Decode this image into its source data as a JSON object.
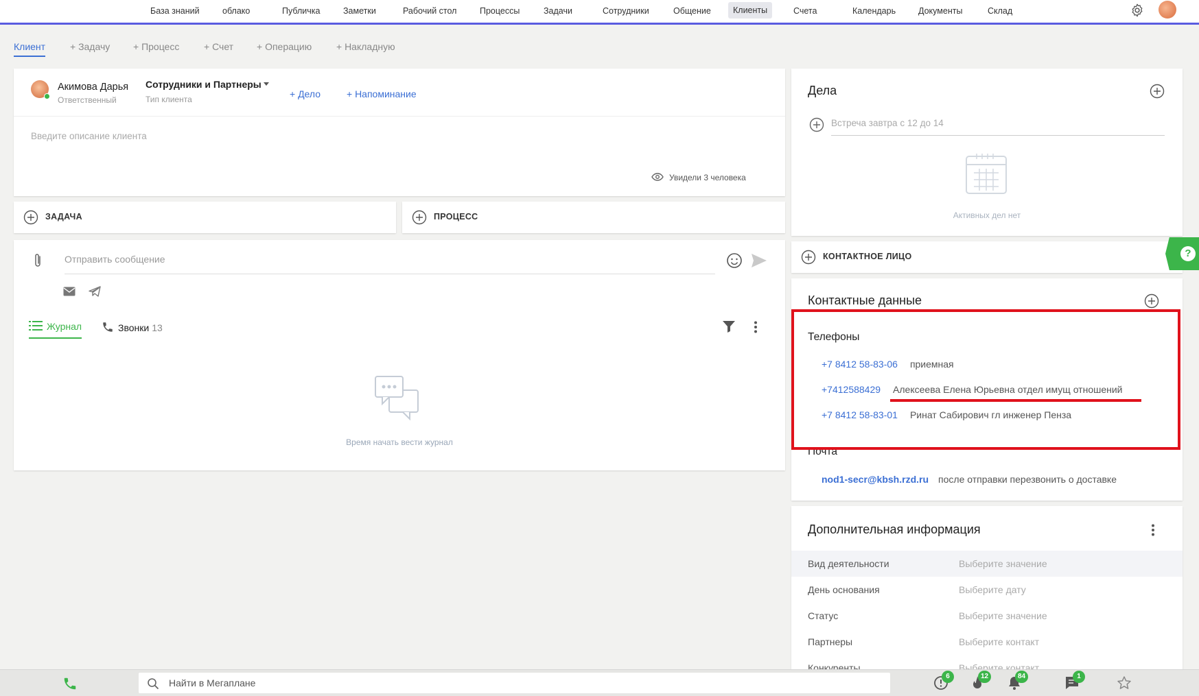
{
  "nav": {
    "items": [
      "База знаний",
      "облако",
      "Публичка",
      "Заметки",
      "Рабочий стол",
      "Процессы",
      "Задачи",
      "Сотрудники",
      "Общение",
      "Клиенты",
      "Счета",
      "Календарь",
      "Документы",
      "Склад"
    ],
    "active": "Клиенты"
  },
  "subtabs": [
    "Клиент",
    "+ Задачу",
    "+ Процесс",
    "+ Счет",
    "+ Операцию",
    "+ Накладную"
  ],
  "client": {
    "name": "Акимова Дарья",
    "role": "Ответственный",
    "type_value": "Сотрудники и Партнеры",
    "type_label": "Тип клиента",
    "add_deal": "+ Дело",
    "add_reminder": "+ Напоминание",
    "description_placeholder": "Введите описание клиента",
    "seen": "Увидели 3 человека"
  },
  "actions": {
    "task": "ЗАДАЧА",
    "process": "ПРОЦЕСС",
    "contact_face": "КОНТАКТНОЕ ЛИЦО"
  },
  "journal": {
    "message_placeholder": "Отправить сообщение",
    "tab_journal": "Журнал",
    "tab_calls": "Звонки",
    "calls_count": "13",
    "empty_text": "Время начать вести журнал"
  },
  "deals": {
    "title": "Дела",
    "input_placeholder": "Встреча завтра с 12 до 14",
    "empty_text": "Активных дел нет"
  },
  "contacts": {
    "title": "Контактные данные",
    "phones_title": "Телефоны",
    "phones": [
      {
        "number": "+7 8412 58-83-06",
        "note": "приемная"
      },
      {
        "number": "+7412588429",
        "note": "Алексеева Елена Юрьевна отдел имущ отношений"
      },
      {
        "number": "+7 8412 58-83-01",
        "note": "Ринат Сабирович гл инженер Пенза"
      }
    ],
    "email_title": "Почта",
    "email": {
      "address": "nod1-secr@kbsh.rzd.ru",
      "note": "после отправки перезвонить о доставке"
    }
  },
  "extra": {
    "title": "Дополнительная информация",
    "fields": [
      {
        "key": "Вид деятельности",
        "value": "Выберите значение"
      },
      {
        "key": "День основания",
        "value": "Выберите дату"
      },
      {
        "key": "Статус",
        "value": "Выберите значение"
      },
      {
        "key": "Партнеры",
        "value": "Выберите контакт"
      },
      {
        "key": "Конкуренты",
        "value": "Выберите контакт"
      }
    ]
  },
  "bottom": {
    "search_placeholder": "Найти в Мегаплане",
    "badges": {
      "reminders": "6",
      "hot": "12",
      "notifications": "84",
      "messages": "1"
    }
  },
  "colors": {
    "accent": "#3b6fd4",
    "green": "#3cb54a",
    "highlight_red": "#e0121c",
    "nav_underline": "#5a5ce0"
  }
}
